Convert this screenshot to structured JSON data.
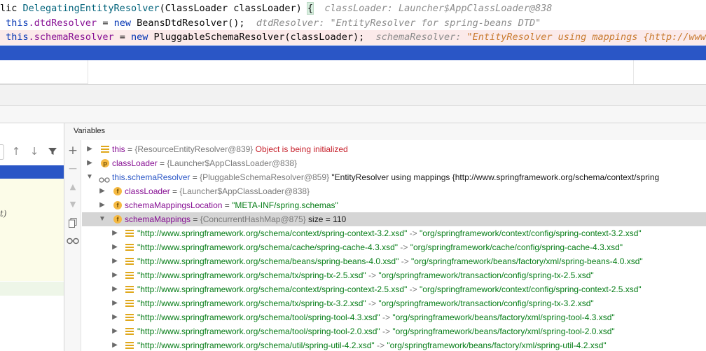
{
  "editor": {
    "line1": {
      "pre": "lic ",
      "cls": "DelegatingEntityResolver",
      "args": "(ClassLoader classLoader) ",
      "brace": "{",
      "hint": "classLoader: Launcher$AppClassLoader@838"
    },
    "line2": {
      "kw": "this",
      "field": ".dtdResolver",
      "op": " = ",
      "new": "new",
      "rest": " BeansDtdResolver();",
      "hint_label": "dtdResolver: ",
      "hint_value": "\"EntityResolver for spring-beans DTD\""
    },
    "line3": {
      "kw": "this",
      "field": ".schemaResolver",
      "op": " = ",
      "new": "new",
      "rest": " PluggableSchemaResolver(classLoader);",
      "hint_label": "schemaResolver: ",
      "hint_value": "\"EntityResolver using mappings {http://www.s"
    }
  },
  "variables": {
    "title": "Variables",
    "rows": [
      {
        "name": "this",
        "ref": "{ResourceEntityResolver@839}",
        "extra": "Object is being initialized",
        "icon": "list-icon"
      },
      {
        "name": "classLoader",
        "ref": "{Launcher$AppClassLoader@838}",
        "icon": "parameter-icon",
        "icon_letter": "p"
      },
      {
        "name": "this.schemaResolver",
        "ref": "{PluggableSchemaResolver@859}",
        "extra": "\"EntityResolver using mappings {http://www.springframework.org/schema/context/spring",
        "icon": "watch-glasses-icon"
      },
      {
        "name": "classLoader",
        "ref": "{Launcher$AppClassLoader@838}",
        "icon": "field-icon",
        "icon_letter": "f"
      },
      {
        "name": "schemaMappingsLocation",
        "value": "\"META-INF/spring.schemas\"",
        "icon": "field-icon",
        "icon_letter": "f"
      },
      {
        "name": "schemaMappings",
        "ref": "{ConcurrentHashMap@875}",
        "extra": "size = 110",
        "icon": "field-icon",
        "icon_letter": "f"
      }
    ],
    "entries": [
      {
        "key": "\"http://www.springframework.org/schema/context/spring-context-3.2.xsd\"",
        "value": "\"org/springframework/context/config/spring-context-3.2.xsd\""
      },
      {
        "key": "\"http://www.springframework.org/schema/cache/spring-cache-4.3.xsd\"",
        "value": "\"org/springframework/cache/config/spring-cache-4.3.xsd\""
      },
      {
        "key": "\"http://www.springframework.org/schema/beans/spring-beans-4.0.xsd\"",
        "value": "\"org/springframework/beans/factory/xml/spring-beans-4.0.xsd\""
      },
      {
        "key": "\"http://www.springframework.org/schema/tx/spring-tx-2.5.xsd\"",
        "value": "\"org/springframework/transaction/config/spring-tx-2.5.xsd\""
      },
      {
        "key": "\"http://www.springframework.org/schema/context/spring-context-2.5.xsd\"",
        "value": "\"org/springframework/context/config/spring-context-2.5.xsd\""
      },
      {
        "key": "\"http://www.springframework.org/schema/tx/spring-tx-3.2.xsd\"",
        "value": "\"org/springframework/transaction/config/spring-tx-3.2.xsd\""
      },
      {
        "key": "\"http://www.springframework.org/schema/tool/spring-tool-4.3.xsd\"",
        "value": "\"org/springframework/beans/factory/xml/spring-tool-4.3.xsd\""
      },
      {
        "key": "\"http://www.springframework.org/schema/tool/spring-tool-2.0.xsd\"",
        "value": "\"org/springframework/beans/factory/xml/spring-tool-2.0.xsd\""
      },
      {
        "key": "\"http://www.springframework.org/schema/util/spring-util-4.2.xsd\"",
        "value": "\"org/springframework/beans/factory/xml/spring-util-4.2.xsd\""
      }
    ],
    "equals": " = ",
    "map_arrow": " -> "
  },
  "frames": {
    "italic_fragment": "t)"
  },
  "icons": {
    "sidebar": [
      "add-icon",
      "remove-icon",
      "move-up-icon",
      "move-down-icon",
      "copy-icon",
      "watches-glasses-icon"
    ],
    "frames_toolbar": [
      "up-arrow-icon",
      "down-arrow-icon",
      "filter-icon"
    ]
  },
  "colors": {
    "selection": "#2a56c6",
    "error_line": "#fbeaea",
    "keyword": "#0033b3",
    "field": "#871094",
    "string": "#067d17",
    "error_text": "#c7222d"
  }
}
